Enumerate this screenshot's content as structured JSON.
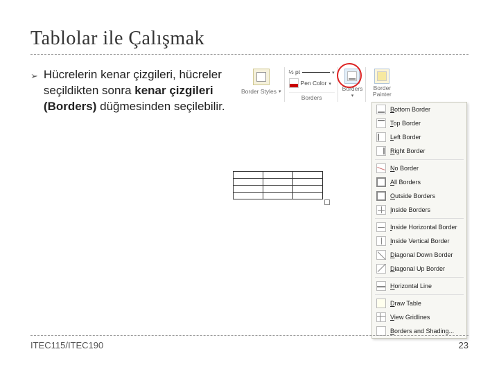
{
  "slide": {
    "title": "Tablolar ile Çalışmak",
    "bullet_arrow": "➢",
    "bullet_text_1": "Hücrelerin kenar çizgileri, hücreler seçildikten sonra ",
    "bullet_text_bold": "kenar çizgileri (Borders)",
    "bullet_text_2": " düğmesinden seçilebilir."
  },
  "ribbon": {
    "border_styles_label": "Border Styles",
    "weight_value": "½ pt",
    "pen_color_label": "Pen Color",
    "borders_group_label": "Borders",
    "borders_btn_label": "Borders",
    "painter_label": "Border Painter"
  },
  "menu": {
    "items": [
      {
        "label": "Bottom Border",
        "iconcls": "i-bottom"
      },
      {
        "label": "Top Border",
        "iconcls": "i-top"
      },
      {
        "label": "Left Border",
        "iconcls": "i-left"
      },
      {
        "label": "Right Border",
        "iconcls": "i-right"
      },
      {
        "sep": true
      },
      {
        "label": "No Border",
        "iconcls": "i-no"
      },
      {
        "label": "All Borders",
        "iconcls": "i-all"
      },
      {
        "label": "Outside Borders",
        "iconcls": "i-out"
      },
      {
        "label": "Inside Borders",
        "iconcls": "i-in"
      },
      {
        "sep": true
      },
      {
        "label": "Inside Horizontal Border",
        "iconcls": "i-inh"
      },
      {
        "label": "Inside Vertical Border",
        "iconcls": "i-inv"
      },
      {
        "label": "Diagonal Down Border",
        "iconcls": "i-dd"
      },
      {
        "label": "Diagonal Up Border",
        "iconcls": "i-du"
      },
      {
        "sep": true
      },
      {
        "label": "Horizontal Line",
        "iconcls": "i-hl"
      },
      {
        "sep": true
      },
      {
        "label": "Draw Table",
        "iconcls": "i-draw"
      },
      {
        "label": "View Gridlines",
        "iconcls": "i-grid"
      },
      {
        "label": "Borders and Shading...",
        "iconcls": ""
      }
    ]
  },
  "footer": {
    "left": "ITEC115/ITEC190",
    "right": "23"
  }
}
